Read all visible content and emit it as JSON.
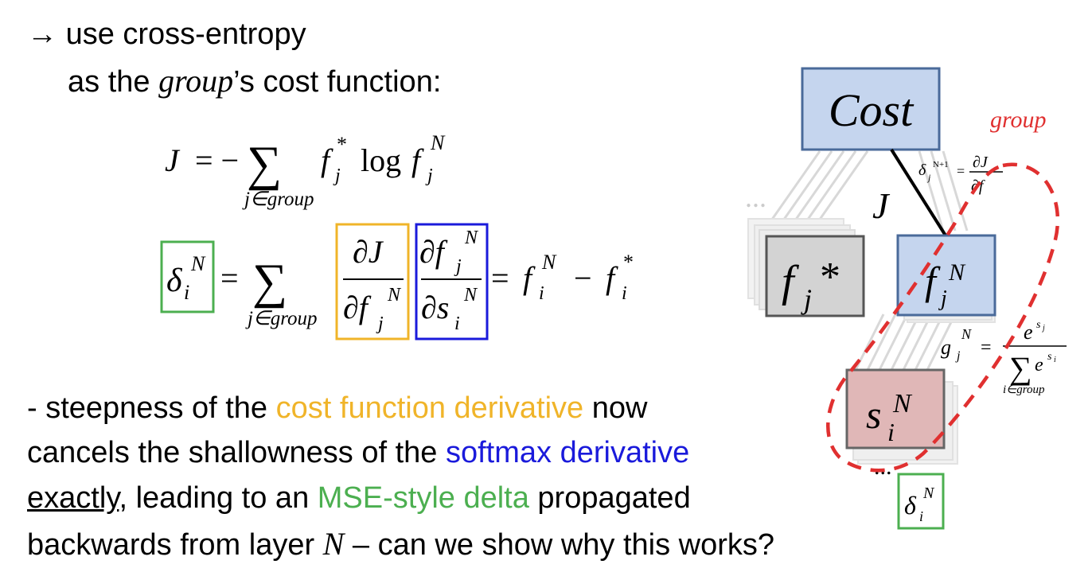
{
  "header": {
    "arrow": "→",
    "line1_rest": "use cross-entropy",
    "line2_pre": "as the ",
    "line2_italic": "group",
    "line2_post": "’s cost function:"
  },
  "eq1": {
    "lhs": "J",
    "eq": "= −",
    "sum": "∑",
    "sub": "j∈group",
    "f": "f",
    "j": "j",
    "star": "*",
    "log": "log",
    "N": "N"
  },
  "eq2": {
    "delta": "δ",
    "i": "i",
    "N": "N",
    "eq": "=",
    "sum": "∑",
    "sub": "j∈group",
    "dJ": "∂J",
    "df": "∂f",
    "ds": "∂s",
    "rhs_eq": "=",
    "f": "f",
    "minus": "−",
    "star": "*"
  },
  "bottom": {
    "l1_a": "- steepness of the ",
    "l1_orange": "cost function derivative",
    "l1_b": " now",
    "l2_a": "cancels the shallowness of the ",
    "l2_blue": "softmax derivative",
    "l3_u": "exactly",
    "l3_a": ", leading to an ",
    "l3_green": "MSE-style delta",
    "l3_b": " propagated",
    "l4_a": "backwards from layer ",
    "l4_N": "N",
    "l4_b": " – can we show why this works?"
  },
  "diagram": {
    "cost": "Cost",
    "group": "group",
    "J": "J",
    "ellipsis": "...",
    "fstar_f": "f",
    "fstar_j": "j",
    "fstar_star": "*",
    "fj_f": "f",
    "fj_j": "j",
    "fj_N": "N",
    "s_s": "s",
    "s_i": "i",
    "s_N": "N",
    "delta_top": "δ",
    "delta_top_j": "j",
    "delta_top_sup": "N+1",
    "delta_top_eq": "=",
    "delta_top_num": "∂J",
    "delta_top_den": "∂f",
    "g": "g",
    "g_j": "j",
    "g_N": "N",
    "g_eq": "=",
    "g_num": "e",
    "g_num_sup": "s",
    "g_num_sup_sub": "j",
    "g_den_sum": "∑",
    "g_den": "e",
    "g_den_sup": "s",
    "g_den_sup_sub": "i",
    "g_den_sub": "i∈group",
    "delta_bot": "δ",
    "delta_bot_i": "i",
    "delta_bot_N": "N",
    "colors": {
      "cost_fill": "#c5d5ee",
      "fj_fill": "#c5d5ee",
      "fstar_fill": "#d3d3d3",
      "s_fill": "#e0b7b7",
      "group_dash": "#e03030"
    }
  },
  "colors": {
    "orange": "#f0b429",
    "blue": "#1a1adb",
    "green": "#4caf50"
  }
}
